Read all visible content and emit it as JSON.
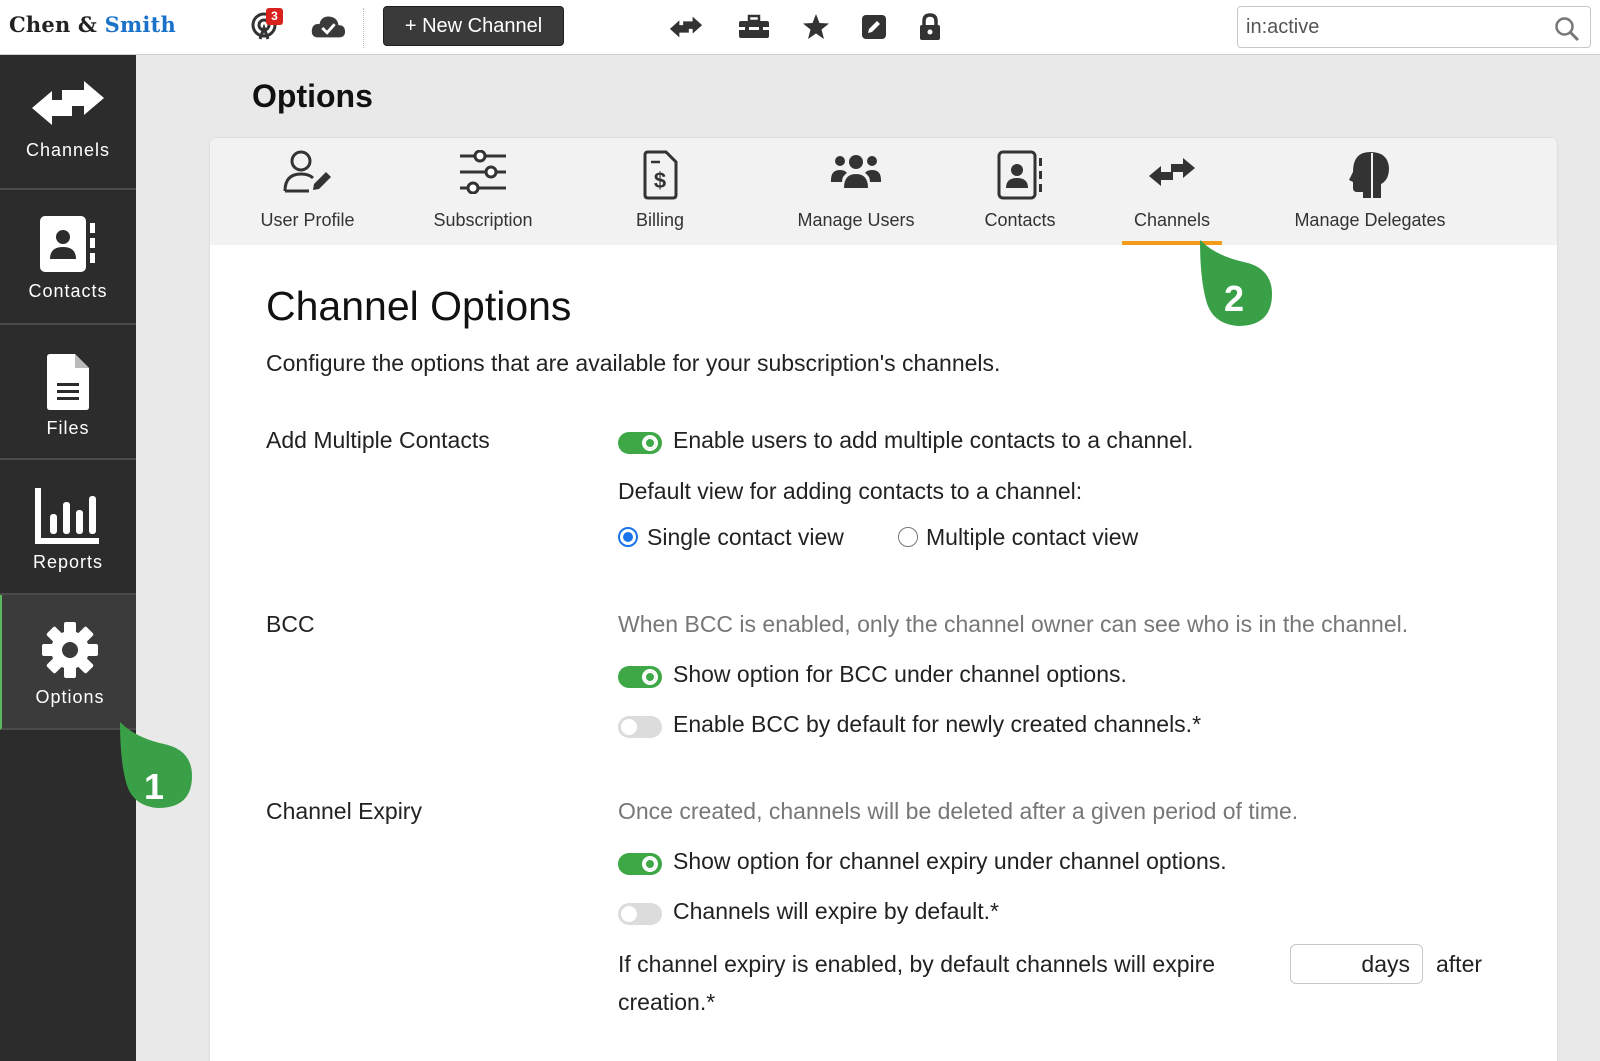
{
  "brand": {
    "part1": "Chen",
    "amp": " & ",
    "part2": "Smith"
  },
  "topbar": {
    "notification_count": "3",
    "new_channel_label": "+ New Channel",
    "search_value": "in:active",
    "icons": [
      "notifications-icon",
      "cloud-sync-icon",
      "channels-icon",
      "toolbox-icon",
      "star-icon",
      "edit-icon",
      "lock-icon",
      "search-icon"
    ]
  },
  "sidebar": {
    "items": [
      {
        "label": "Channels",
        "icon": "channels-icon"
      },
      {
        "label": "Contacts",
        "icon": "contacts-icon"
      },
      {
        "label": "Files",
        "icon": "file-icon"
      },
      {
        "label": "Reports",
        "icon": "reports-icon"
      },
      {
        "label": "Options",
        "icon": "gear-icon",
        "active": true
      }
    ]
  },
  "page": {
    "title": "Options"
  },
  "tabs": [
    {
      "label": "User Profile",
      "icon": "user-edit-icon"
    },
    {
      "label": "Subscription",
      "icon": "sliders-icon"
    },
    {
      "label": "Billing",
      "icon": "billing-icon"
    },
    {
      "label": "Manage Users",
      "icon": "users-icon"
    },
    {
      "label": "Contacts",
      "icon": "contacts-book-icon"
    },
    {
      "label": "Channels",
      "icon": "channels-icon",
      "active": true
    },
    {
      "label": "Manage Delegates",
      "icon": "delegate-head-icon"
    }
  ],
  "content": {
    "heading": "Channel Options",
    "intro": "Configure the options that are available for your subscription's channels.",
    "add_multiple": {
      "label": "Add Multiple Contacts",
      "toggle_label": "Enable users to add multiple contacts to a channel.",
      "toggle_on": true,
      "default_view_label": "Default view for adding contacts to a channel:",
      "radio_single": "Single contact view",
      "radio_multiple": "Multiple contact view",
      "selected": "single"
    },
    "bcc": {
      "label": "BCC",
      "description": "When BCC is enabled, only the channel owner can see who is in the channel.",
      "show_option_label": "Show option for BCC under channel options.",
      "show_option_on": true,
      "default_label": "Enable BCC by default for newly created channels.*",
      "default_on": false
    },
    "expiry": {
      "label": "Channel Expiry",
      "description": "Once created, channels will be deleted after a given period of time.",
      "show_option_label": "Show option for channel expiry under channel options.",
      "show_option_on": true,
      "default_label": "Channels will expire by default.*",
      "default_on": false,
      "sentence_before": "If channel expiry is enabled, by default channels will expire",
      "days_label": "days",
      "sentence_after": "after",
      "sentence_end": "creation.*"
    }
  },
  "callouts": [
    {
      "number": "1",
      "color": "#3aa048"
    },
    {
      "number": "2",
      "color": "#3aa048"
    }
  ]
}
